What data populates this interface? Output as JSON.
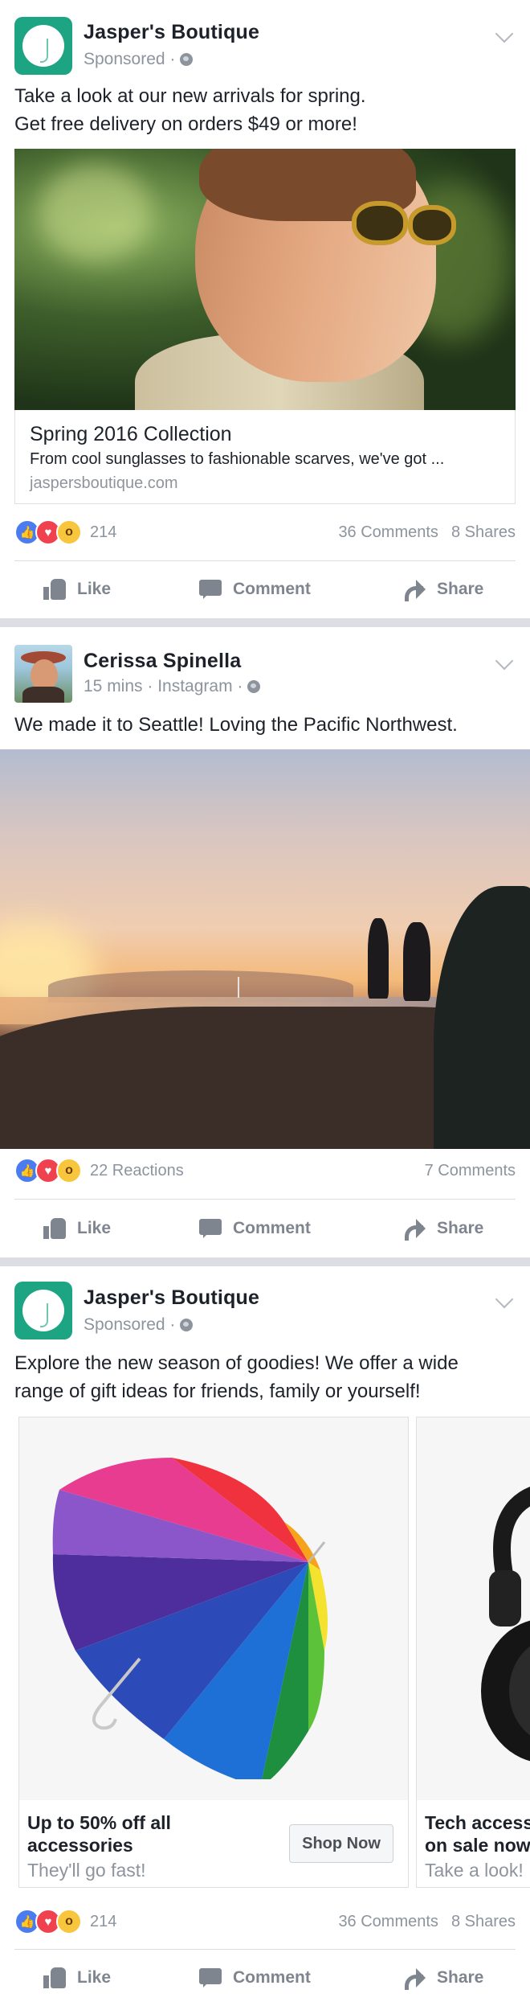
{
  "posts": [
    {
      "author": "Jasper's Boutique",
      "meta": "Sponsored ·",
      "text_lines": [
        "Take a look at our new arrivals for spring.",
        "Get free delivery on orders $49 or more!"
      ],
      "link": {
        "title": "Spring 2016 Collection",
        "description": "From cool sunglasses to fashionable scarves, we've got ...",
        "url": "jaspersboutique.com"
      },
      "reactions": {
        "count": "214",
        "comments": "36 Comments",
        "shares": "8 Shares"
      }
    },
    {
      "author": "Cerissa Spinella",
      "meta": "15 mins · Instagram ·",
      "text_lines": [
        "We made it to Seattle! Loving the Pacific Northwest."
      ],
      "reactions": {
        "count": "22 Reactions",
        "comments": "7 Comments"
      }
    },
    {
      "author": "Jasper's Boutique",
      "meta": "Sponsored ·",
      "text_lines": [
        "Explore the new season of goodies! We offer a wide",
        "range of gift ideas for friends, family or yourself!"
      ],
      "carousel": [
        {
          "title_lines": [
            "Up to 50% off all",
            "accessories"
          ],
          "subtitle": "They'll go fast!",
          "button": "Shop Now"
        },
        {
          "title_lines": [
            "Tech accessories",
            "on sale now"
          ],
          "subtitle": "Take a look!"
        }
      ],
      "reactions": {
        "count": "214",
        "comments": "36 Comments",
        "shares": "8 Shares"
      }
    }
  ],
  "actions": {
    "like": "Like",
    "comment": "Comment",
    "share": "Share"
  },
  "reaction_icons": [
    "like-reaction-icon",
    "love-reaction-icon",
    "wow-reaction-icon"
  ],
  "reaction_glyphs": {
    "like": "👍",
    "love": "♥",
    "wow": "o"
  },
  "colors": {
    "brand_green": "#1ca483",
    "like_blue": "#4a7cf0",
    "love_red": "#f0424e",
    "wow_yellow": "#f7c63c",
    "muted_gray": "#8d949e",
    "separator": "#dcdee3"
  }
}
